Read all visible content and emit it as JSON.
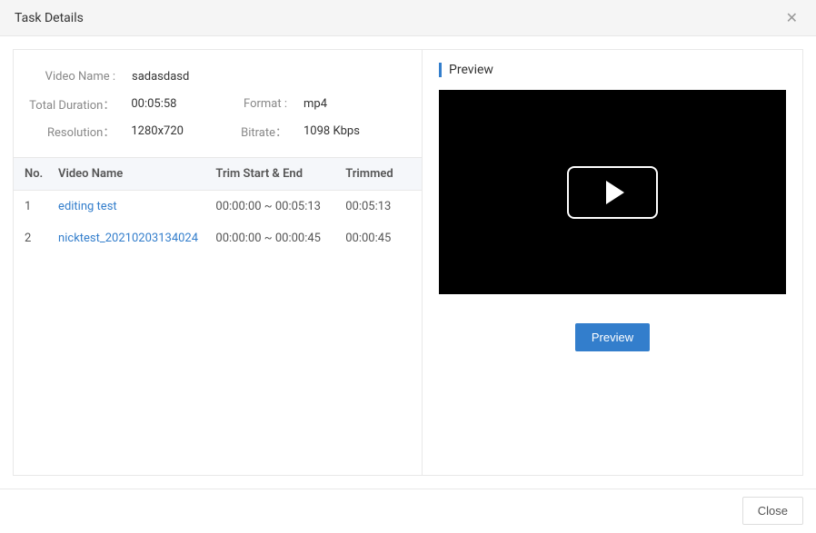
{
  "dialog": {
    "title": "Task Details",
    "closeLabel": "Close"
  },
  "info": {
    "videoNameLabel": "Video Name :",
    "videoName": "sadasdasd",
    "totalDurationLabel": "Total Duration：",
    "totalDuration": "00:05:58",
    "formatLabel": "Format :",
    "format": "mp4",
    "resolutionLabel": "Resolution：",
    "resolution": "1280x720",
    "bitrateLabel": "Bitrate：",
    "bitrate": "1098 Kbps"
  },
  "table": {
    "headers": {
      "no": "No.",
      "videoName": "Video Name",
      "trim": "Trim Start & End",
      "trimmed": "Trimmed"
    },
    "rows": [
      {
        "no": "1",
        "name": "editing test",
        "trim": "00:00:00 ~ 00:05:13",
        "trimmed": "00:05:13"
      },
      {
        "no": "2",
        "name": "nicktest_20210203134024",
        "trim": "00:00:00 ~ 00:00:45",
        "trimmed": "00:00:45"
      }
    ]
  },
  "preview": {
    "title": "Preview",
    "buttonLabel": "Preview"
  }
}
